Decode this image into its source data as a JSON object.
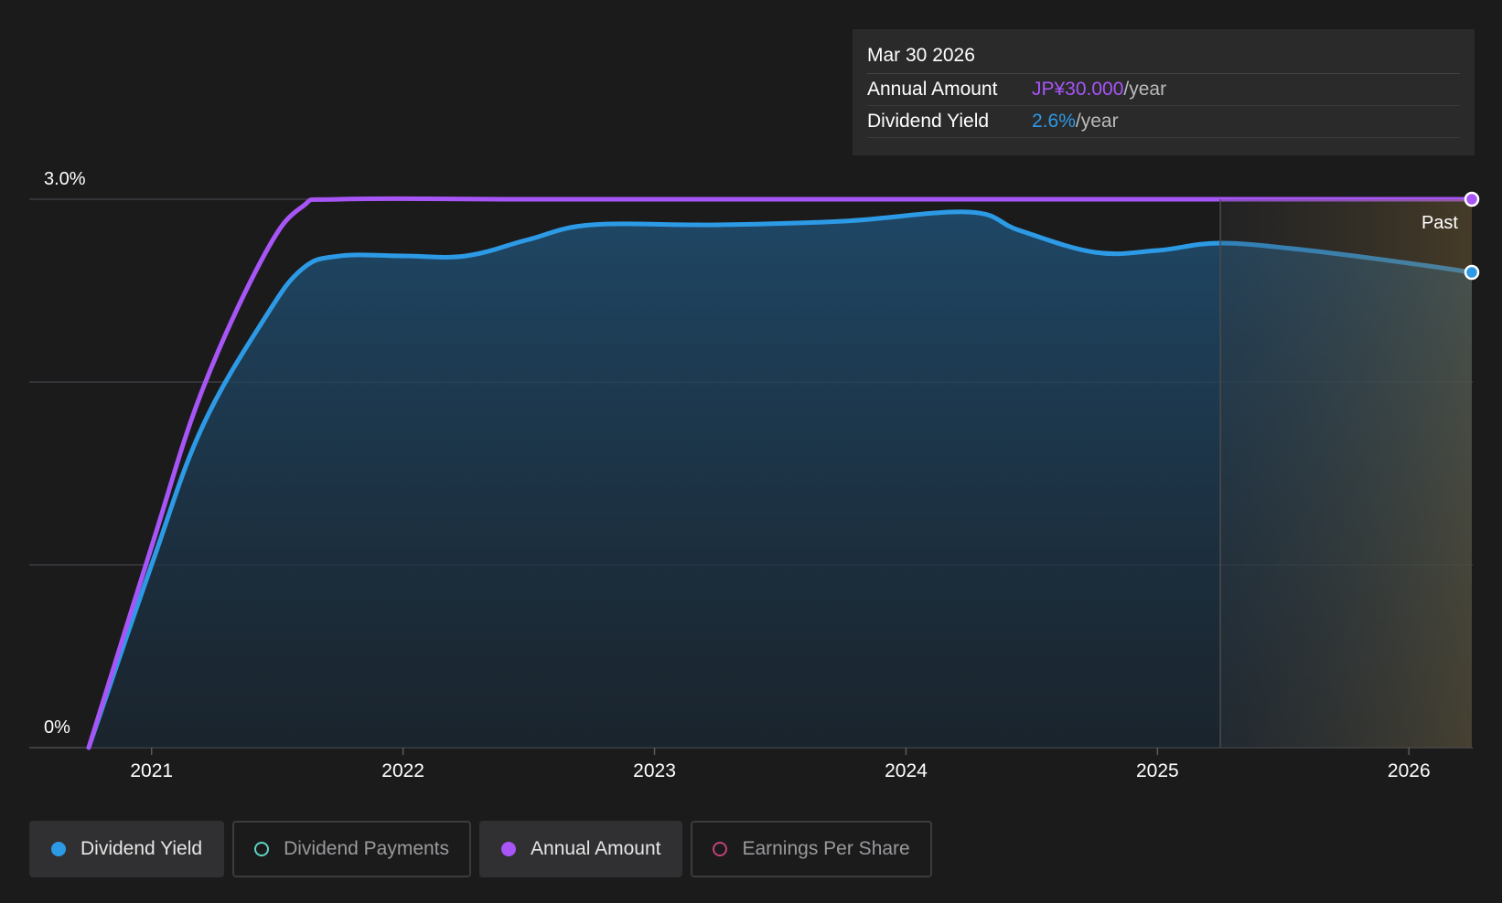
{
  "tooltip": {
    "date": "Mar 30 2026",
    "rows": [
      {
        "label": "Annual Amount",
        "value": "JP¥30.000",
        "unit": "/year",
        "color": "#a855f7"
      },
      {
        "label": "Dividend Yield",
        "value": "2.6%",
        "unit": "/year",
        "color": "#2d9ae6"
      }
    ]
  },
  "legend": [
    {
      "label": "Dividend Yield",
      "color": "#2d9ae6",
      "active": true,
      "filled": true
    },
    {
      "label": "Dividend Payments",
      "color": "#5fd3c3",
      "active": false,
      "filled": false
    },
    {
      "label": "Annual Amount",
      "color": "#a855f7",
      "active": true,
      "filled": true
    },
    {
      "label": "Earnings Per Share",
      "color": "#c0427a",
      "active": false,
      "filled": false
    }
  ],
  "chart_data": {
    "type": "line",
    "x_range": [
      2020.75,
      2026.25
    ],
    "y_range": [
      0,
      3.0
    ],
    "y_ticks": [
      {
        "value": 3.0,
        "label": "3.0%"
      },
      {
        "value": 0,
        "label": "0%"
      }
    ],
    "x_ticks": [
      {
        "value": 2021,
        "label": "2021"
      },
      {
        "value": 2022,
        "label": "2022"
      },
      {
        "value": 2023,
        "label": "2023"
      },
      {
        "value": 2024,
        "label": "2024"
      },
      {
        "value": 2025,
        "label": "2025"
      },
      {
        "value": 2026,
        "label": "2026"
      }
    ],
    "past_start": 2025.25,
    "past_label": "Past",
    "series": [
      {
        "name": "Annual Amount",
        "color": "#a855f7",
        "points": [
          [
            2020.75,
            0
          ],
          [
            2021.0,
            1.1
          ],
          [
            2021.2,
            1.95
          ],
          [
            2021.45,
            2.7
          ],
          [
            2021.6,
            2.96
          ],
          [
            2021.75,
            3.0
          ],
          [
            2022.5,
            3.0
          ],
          [
            2023.5,
            3.0
          ],
          [
            2024.5,
            3.0
          ],
          [
            2025.5,
            3.0
          ],
          [
            2026.25,
            3.0
          ]
        ]
      },
      {
        "name": "Dividend Yield",
        "color": "#2d9ae6",
        "area": true,
        "points": [
          [
            2020.75,
            0
          ],
          [
            2021.0,
            1.0
          ],
          [
            2021.2,
            1.75
          ],
          [
            2021.45,
            2.35
          ],
          [
            2021.6,
            2.62
          ],
          [
            2021.75,
            2.69
          ],
          [
            2022.0,
            2.69
          ],
          [
            2022.25,
            2.69
          ],
          [
            2022.5,
            2.78
          ],
          [
            2022.75,
            2.86
          ],
          [
            2023.25,
            2.86
          ],
          [
            2023.75,
            2.88
          ],
          [
            2024.25,
            2.93
          ],
          [
            2024.45,
            2.83
          ],
          [
            2024.75,
            2.71
          ],
          [
            2025.0,
            2.72
          ],
          [
            2025.25,
            2.76
          ],
          [
            2025.6,
            2.72
          ],
          [
            2026.0,
            2.65
          ],
          [
            2026.25,
            2.6
          ]
        ]
      }
    ]
  }
}
